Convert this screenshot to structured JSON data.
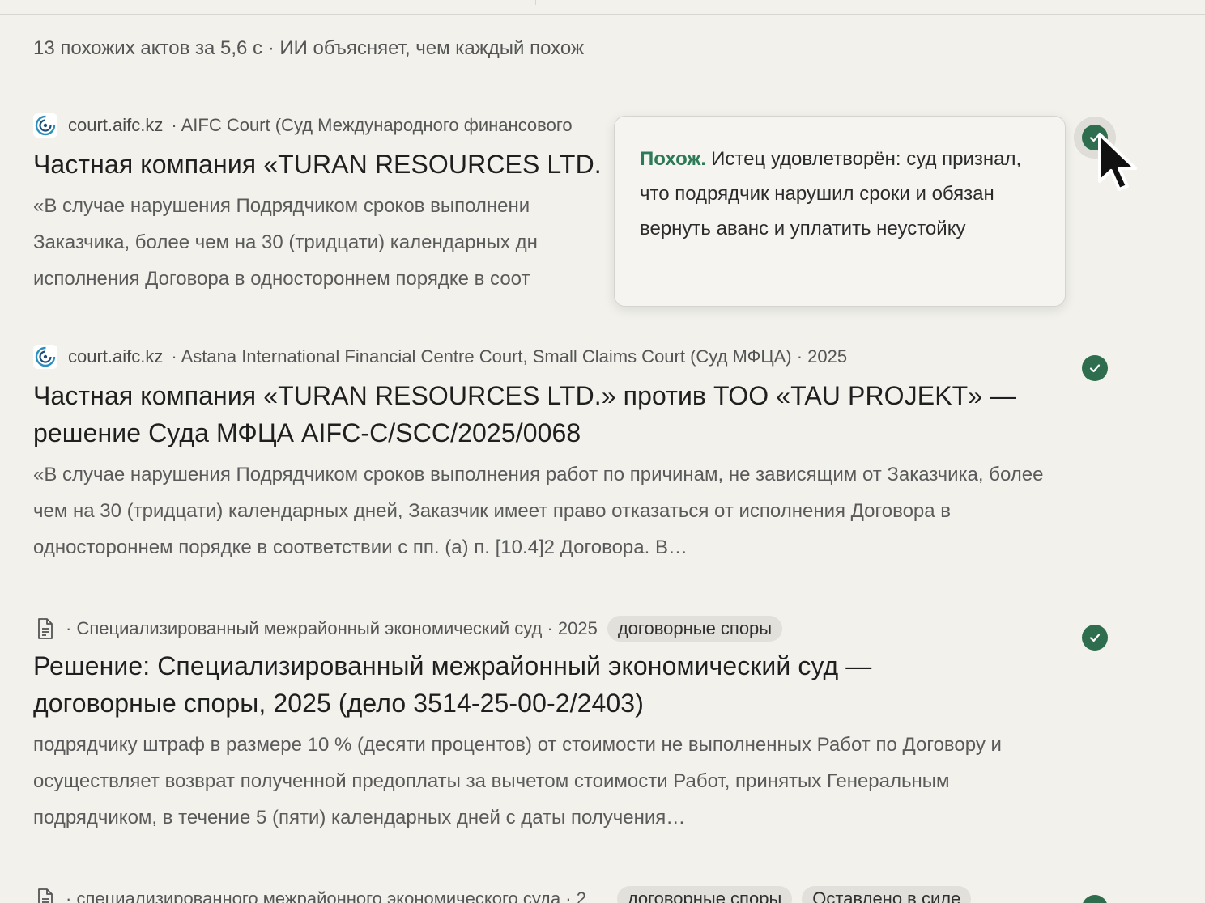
{
  "summary": "13 похожих актов за 5,6 с · ИИ объясняет, чем каждый похож",
  "results": [
    {
      "domain": "court.aifc.kz",
      "court": "· AIFC Court (Суд Международного финансового",
      "title": "Частная компания «TURAN RESOURCES LTD.",
      "snippet": "«В случае нарушения Подрядчиком сроков выполнени Заказчика, более чем на 30 (тридцати) календарных дн исполнения Договора в одностороннем порядке в соот",
      "icon": "court-logo-icon"
    },
    {
      "domain": "court.aifc.kz",
      "court": "· Astana International Financial Centre Court, Small Claims Court (Суд МФЦА) · 2025",
      "title": "Частная компания «TURAN RESOURCES LTD.» против ТОО «TAU PROJEKT» — решение Суда МФЦА AIFC-C/SCC/2025/0068",
      "snippet": "«В случае нарушения Подрядчиком сроков выполнения работ по причинам, не зависящим от Заказчика, более чем на 30 (тридцати) календарных дней, Заказчик имеет право отказаться от исполнения Договора в одностороннем порядке в соответствии с пп. (а) п. [10.4]2 Договора. В…",
      "icon": "court-logo-icon"
    },
    {
      "court": "· Специализированный межрайонный экономический суд · 2025",
      "tag": "договорные споры",
      "title": "Решение: Специализированный межрайонный экономический суд — договорные споры, 2025 (дело 3514-25-00-2/2403)",
      "snippet": "подрядчику штраф в размере 10 % (десяти процентов) от стоимости не выполненных Работ по Договору и осуществляет возврат полученной предоплаты за вычетом стоимости Работ, принятых Генеральным подрядчиком, в течение 5 (пяти) календарных дней с даты получения…",
      "icon": "document-icon"
    },
    {
      "court": "· специализированного межрайонного экономического суда · 2",
      "tags": [
        "договорные споры",
        "Оставлено в силе"
      ],
      "icon": "document-icon"
    }
  ],
  "popover": {
    "verdict": "Похож.",
    "text": "Истец удовлетворён: суд признал, что подрядчик нарушил сроки и обязан вернуть аванс и уплатить неустойку"
  },
  "colors": {
    "background": "#f2f1ec",
    "accent_green": "#2e6d4e",
    "verdict_green": "#2e7a56",
    "tag_bg": "#e2e0da"
  }
}
